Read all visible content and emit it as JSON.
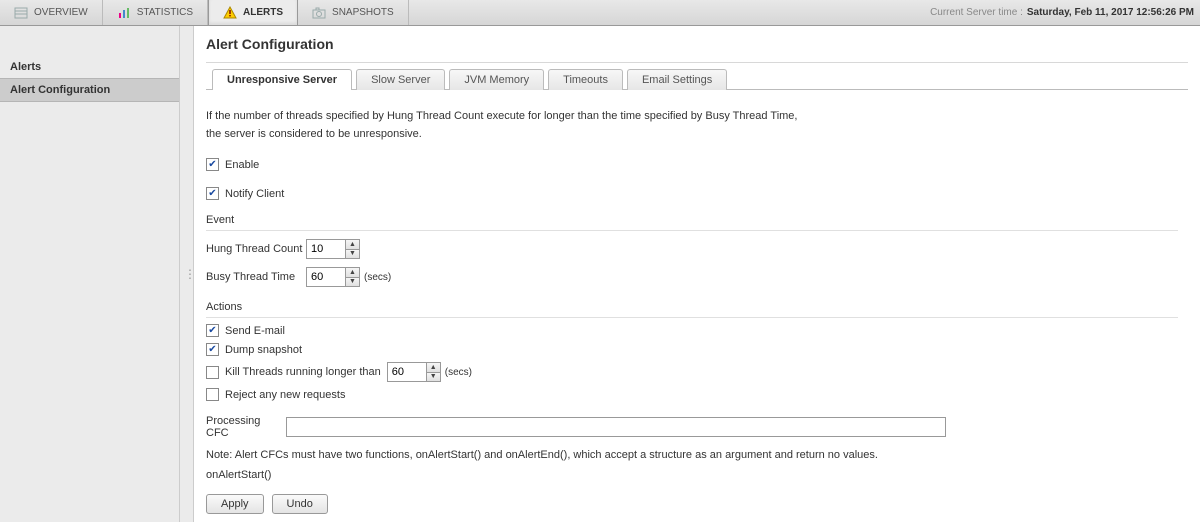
{
  "topnav": {
    "items": [
      {
        "label": "OVERVIEW"
      },
      {
        "label": "STATISTICS"
      },
      {
        "label": "ALERTS",
        "active": true
      },
      {
        "label": "SNAPSHOTS"
      }
    ],
    "server_time_label": "Current Server time :",
    "server_time_value": "Saturday, Feb 11, 2017  12:56:26 PM"
  },
  "sidebar": {
    "items": [
      {
        "label": "Alerts"
      },
      {
        "label": "Alert Configuration",
        "active": true
      }
    ]
  },
  "page": {
    "title": "Alert Configuration",
    "tabs": [
      {
        "label": "Unresponsive Server",
        "active": true
      },
      {
        "label": "Slow Server"
      },
      {
        "label": "JVM Memory"
      },
      {
        "label": "Timeouts"
      },
      {
        "label": "Email Settings"
      }
    ],
    "desc_line1": "If the number of threads specified by Hung Thread Count execute for longer than the time specified by Busy Thread Time,",
    "desc_line2": "the server is considered to be unresponsive.",
    "enable_label": "Enable",
    "notify_label": "Notify Client",
    "event_heading": "Event",
    "hung_label": "Hung Thread Count",
    "hung_value": "10",
    "busy_label": "Busy Thread Time",
    "busy_value": "60",
    "busy_unit": "(secs)",
    "actions_heading": "Actions",
    "send_email_label": "Send E-mail",
    "dump_label": "Dump snapshot",
    "kill_label": "Kill Threads running longer than",
    "kill_value": "60",
    "kill_unit": "(secs)",
    "reject_label": "Reject any new requests",
    "cfc_label": "Processing CFC",
    "cfc_value": "",
    "note": "Note: Alert CFCs must have two functions, onAlertStart() and onAlertEnd(), which accept a structure as an argument and return no values.",
    "on_start": "onAlertStart()",
    "apply": "Apply",
    "undo": "Undo"
  }
}
